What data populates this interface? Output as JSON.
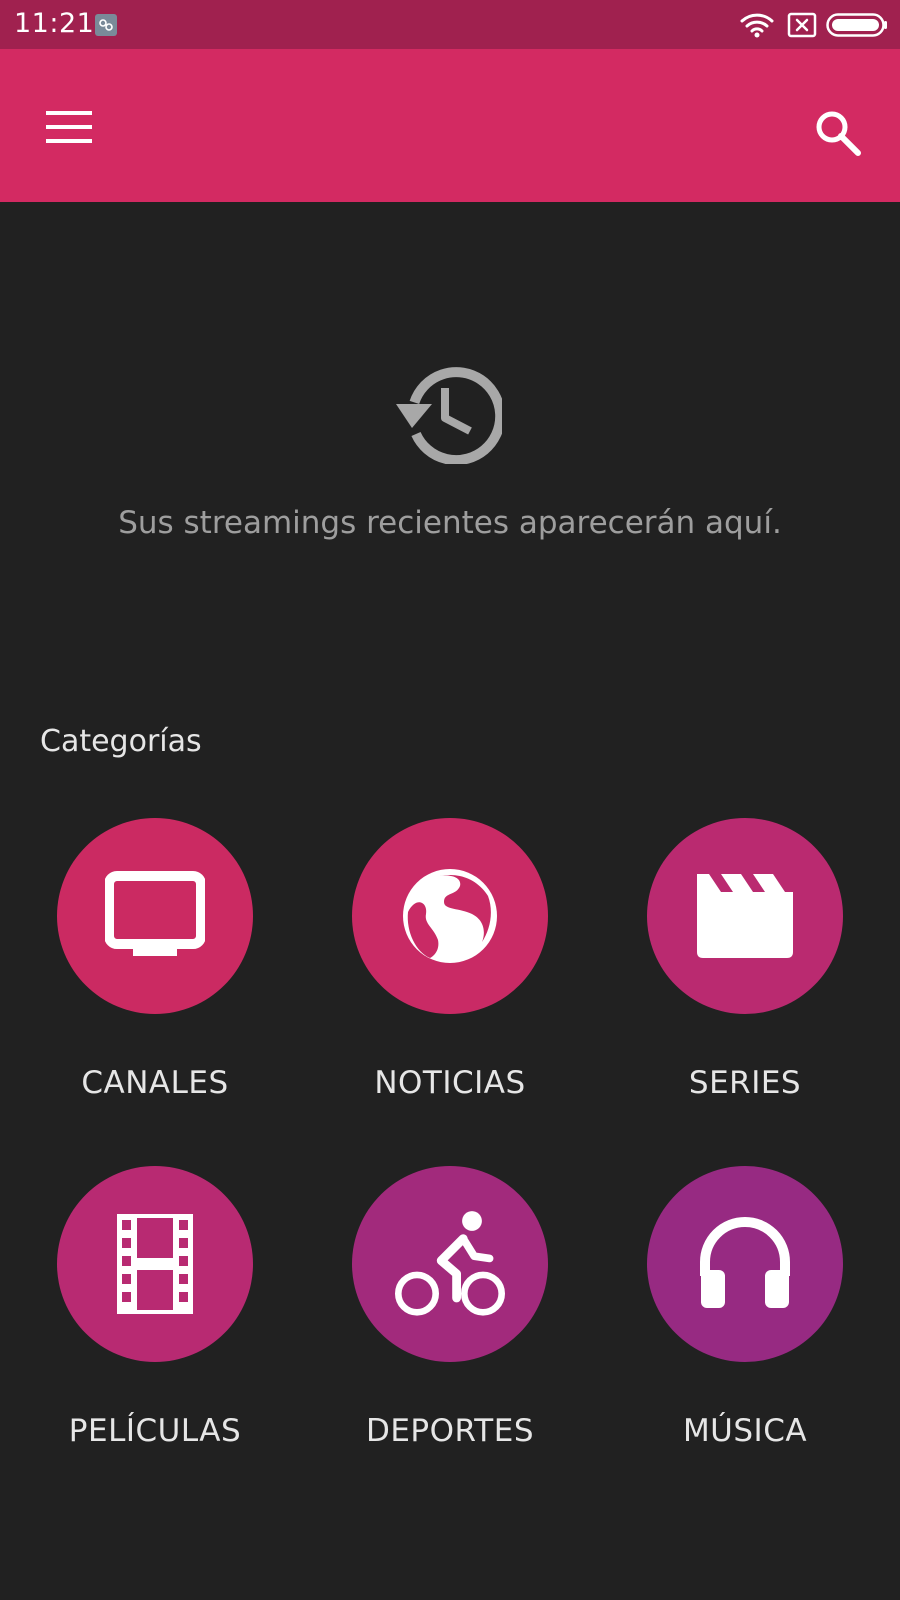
{
  "status_bar": {
    "time": "11:21",
    "icons": [
      "notification-icon",
      "wifi-icon",
      "no-sim-icon",
      "battery-icon"
    ]
  },
  "app_bar": {
    "title": "",
    "icons": [
      "menu-icon",
      "search-icon"
    ]
  },
  "recent": {
    "icon": "history-icon",
    "message": "Sus streamings recientes aparecerán aquí."
  },
  "categories": {
    "title": "Categorías",
    "items": [
      {
        "label": "CANALES",
        "icon": "tv-icon",
        "color": "#cb2a62"
      },
      {
        "label": "NOTICIAS",
        "icon": "globe-icon",
        "color": "#c92a65"
      },
      {
        "label": "SERIES",
        "icon": "clapperboard-icon",
        "color": "#ba2a70"
      },
      {
        "label": "PELÍCULAS",
        "icon": "film-strip-icon",
        "color": "#b82a72"
      },
      {
        "label": "DEPORTES",
        "icon": "bicycle-icon",
        "color": "#a22a7c"
      },
      {
        "label": "MÚSICA",
        "icon": "headphones-icon",
        "color": "#972a82"
      }
    ]
  },
  "colors": {
    "status_bar": "#a0214f",
    "app_bar": "#d32a62",
    "background": "#212121",
    "secondary_text": "#9e9e9e",
    "primary_text": "#e6e6e6"
  }
}
